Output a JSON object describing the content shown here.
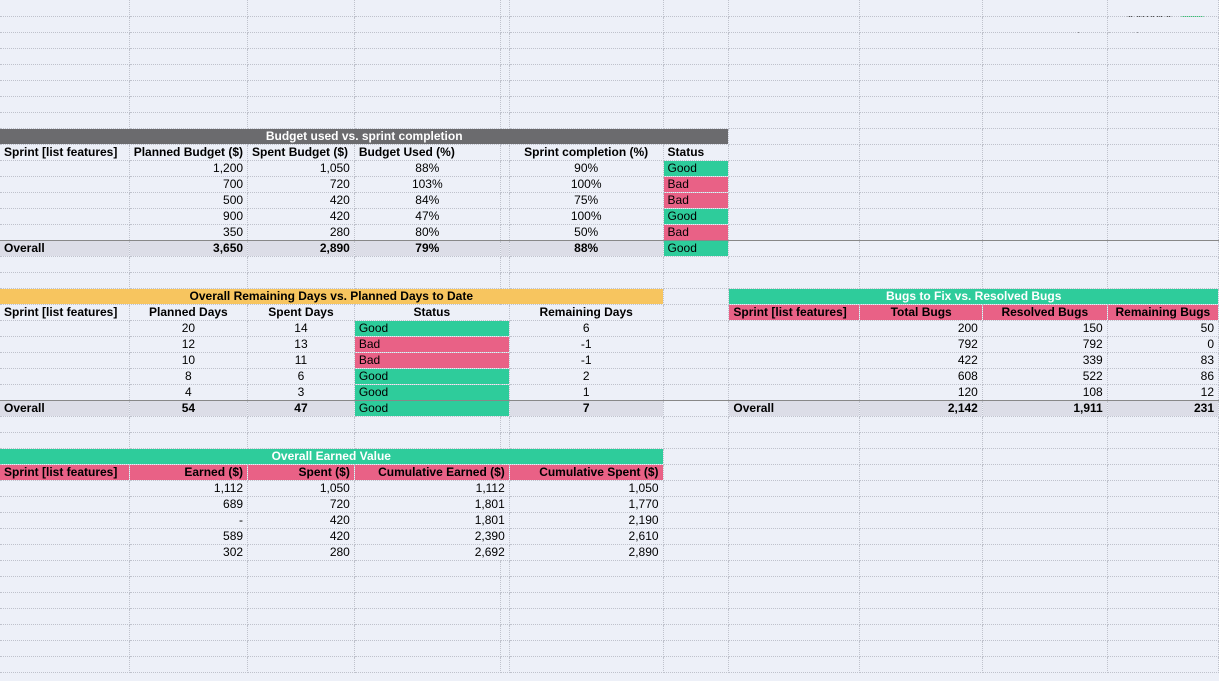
{
  "brand": {
    "name": "status",
    "pill": "net",
    "tagline": "Automate your reporting with status.net"
  },
  "labels": {
    "sprint_col": "Sprint [list features]",
    "overall": "Overall"
  },
  "budget": {
    "title": "Budget used vs. sprint completion",
    "headers": {
      "planned": "Planned Budget ($)",
      "spent": "Spent Budget ($)",
      "used": "Budget Used (%)",
      "completion": "Sprint completion (%)",
      "status": "Status"
    },
    "rows": [
      {
        "planned": "1,200",
        "spent": "1,050",
        "used": "88%",
        "completion": "90%",
        "status": "Good"
      },
      {
        "planned": "700",
        "spent": "720",
        "used": "103%",
        "completion": "100%",
        "status": "Bad"
      },
      {
        "planned": "500",
        "spent": "420",
        "used": "84%",
        "completion": "75%",
        "status": "Bad"
      },
      {
        "planned": "900",
        "spent": "420",
        "used": "47%",
        "completion": "100%",
        "status": "Good"
      },
      {
        "planned": "350",
        "spent": "280",
        "used": "80%",
        "completion": "50%",
        "status": "Bad"
      }
    ],
    "overall": {
      "planned": "3,650",
      "spent": "2,890",
      "used": "79%",
      "completion": "88%",
      "status": "Good"
    }
  },
  "days": {
    "title": "Overall Remaining Days vs. Planned Days to Date",
    "headers": {
      "planned": "Planned Days",
      "spent": "Spent Days",
      "status": "Status",
      "remaining": "Remaining Days"
    },
    "rows": [
      {
        "planned": "20",
        "spent": "14",
        "status": "Good",
        "remaining": "6"
      },
      {
        "planned": "12",
        "spent": "13",
        "status": "Bad",
        "remaining": "-1"
      },
      {
        "planned": "10",
        "spent": "11",
        "status": "Bad",
        "remaining": "-1"
      },
      {
        "planned": "8",
        "spent": "6",
        "status": "Good",
        "remaining": "2"
      },
      {
        "planned": "4",
        "spent": "3",
        "status": "Good",
        "remaining": "1"
      }
    ],
    "overall": {
      "planned": "54",
      "spent": "47",
      "status": "Good",
      "remaining": "7"
    }
  },
  "bugs": {
    "title": "Bugs to Fix vs. Resolved Bugs",
    "headers": {
      "total": "Total Bugs",
      "resolved": "Resolved Bugs",
      "remaining": "Remaining Bugs"
    },
    "rows": [
      {
        "total": "200",
        "resolved": "150",
        "remaining": "50"
      },
      {
        "total": "792",
        "resolved": "792",
        "remaining": "0"
      },
      {
        "total": "422",
        "resolved": "339",
        "remaining": "83"
      },
      {
        "total": "608",
        "resolved": "522",
        "remaining": "86"
      },
      {
        "total": "120",
        "resolved": "108",
        "remaining": "12"
      }
    ],
    "overall": {
      "total": "2,142",
      "resolved": "1,911",
      "remaining": "231"
    }
  },
  "earned": {
    "title": "Overall Earned Value",
    "headers": {
      "earned": "Earned ($)",
      "spent": "Spent ($)",
      "cearned": "Cumulative Earned ($)",
      "cspent": "Cumulative Spent ($)"
    },
    "rows": [
      {
        "earned": "1,112",
        "spent": "1,050",
        "cearned": "1,112",
        "cspent": "1,050"
      },
      {
        "earned": "689",
        "spent": "720",
        "cearned": "1,801",
        "cspent": "1,770"
      },
      {
        "earned": "-",
        "spent": "420",
        "cearned": "1,801",
        "cspent": "2,190"
      },
      {
        "earned": "589",
        "spent": "420",
        "cearned": "2,390",
        "cspent": "2,610"
      },
      {
        "earned": "302",
        "spent": "280",
        "cearned": "2,692",
        "cspent": "2,890"
      }
    ]
  }
}
